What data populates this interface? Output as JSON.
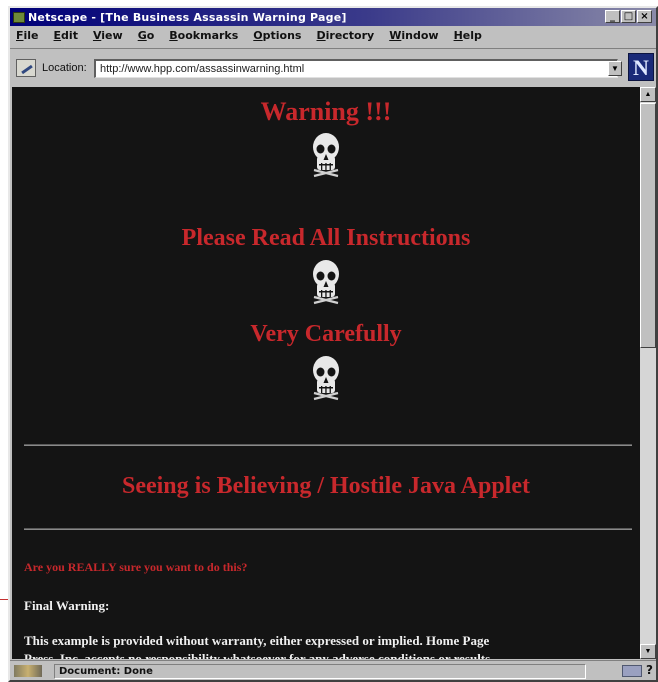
{
  "window": {
    "title": "Netscape - [The Business Assassin Warning Page]",
    "buttons": [
      "_",
      "□",
      "×"
    ]
  },
  "menu": [
    "File",
    "Edit",
    "View",
    "Go",
    "Bookmarks",
    "Options",
    "Directory",
    "Window",
    "Help"
  ],
  "location": {
    "label": "Location:",
    "url": "http://www.hpp.com/assassinwarning.html",
    "logo": "N"
  },
  "page": {
    "background": "#141414",
    "accent": "#c8282c",
    "warning": "Warning !!!",
    "read_instructions": "Please Read All Instructions",
    "very_carefully": "Very Carefully",
    "applet_title": "Seeing is Believing / Hostile Java Applet",
    "question": "Are you REALLY sure you want to do this?",
    "final_warning": "Final Warning:",
    "disclaimer_line1": "This example is provided without warranty, either expressed or implied. Home Page",
    "disclaimer_line2": "Press, Inc. accepts no responsibility whatsoever for any adverse conditions or results"
  },
  "status": {
    "text": "Document: Done",
    "help": "?"
  }
}
